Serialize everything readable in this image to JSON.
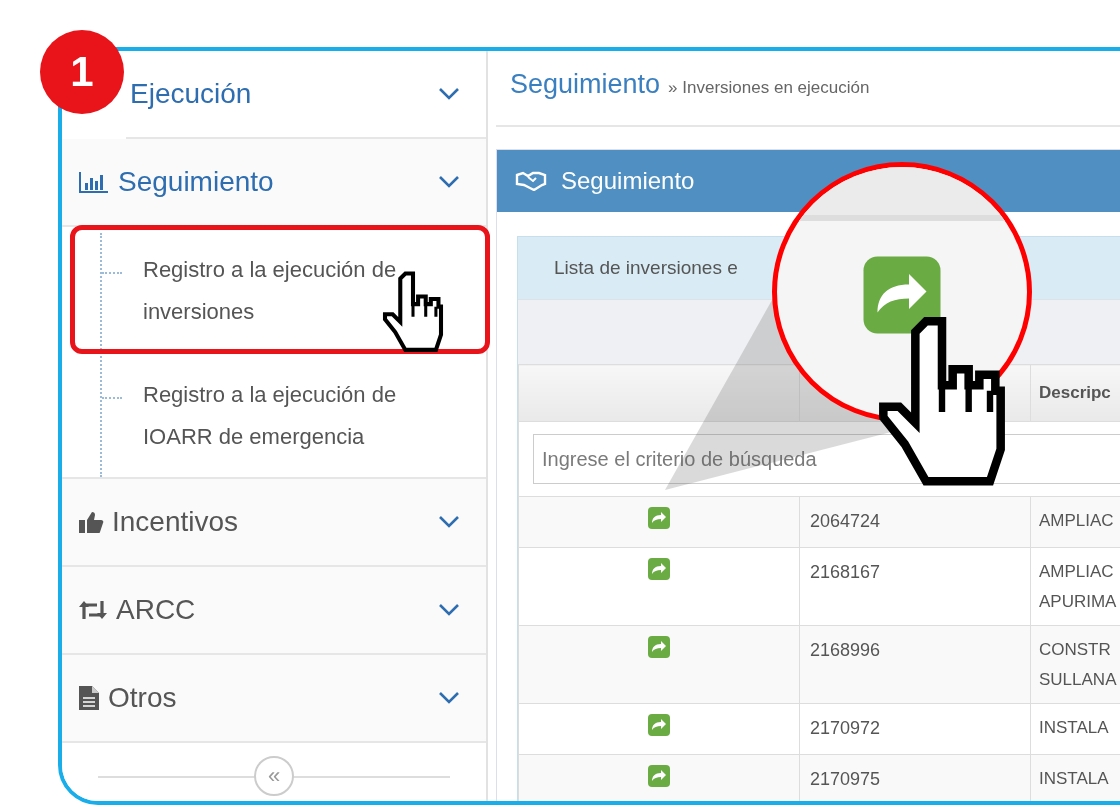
{
  "step_badge": "1",
  "sidebar": {
    "items": [
      {
        "label": "Ejecución",
        "active": true
      },
      {
        "label": "Seguimiento",
        "active": true,
        "children": [
          {
            "label": "Registro a la ejecución de inversiones",
            "highlighted": true
          },
          {
            "label": "Registro a la ejecución de IOARR de emergencia",
            "highlighted": false
          }
        ]
      },
      {
        "label": "Incentivos",
        "active": false
      },
      {
        "label": "ARCC",
        "active": false
      },
      {
        "label": "Otros",
        "active": false
      }
    ],
    "collapse_button": "«"
  },
  "breadcrumb": {
    "section": "Seguimiento",
    "page": "» Inversiones en ejecución"
  },
  "panel": {
    "title": "Seguimiento",
    "card_title": "Lista de inversiones e",
    "table": {
      "description_header": "Descripc",
      "search_placeholder": "Ingrese el criterio de búsqueda",
      "rows": [
        {
          "code": "2064724",
          "description": "AMPLIAC"
        },
        {
          "code": "2168167",
          "description": "AMPLIAC APURIMA"
        },
        {
          "code": "2168996",
          "description": "CONSTR SULLANA"
        },
        {
          "code": "2170972",
          "description": "INSTALA"
        },
        {
          "code": "2170975",
          "description": "INSTALA"
        }
      ]
    }
  }
}
